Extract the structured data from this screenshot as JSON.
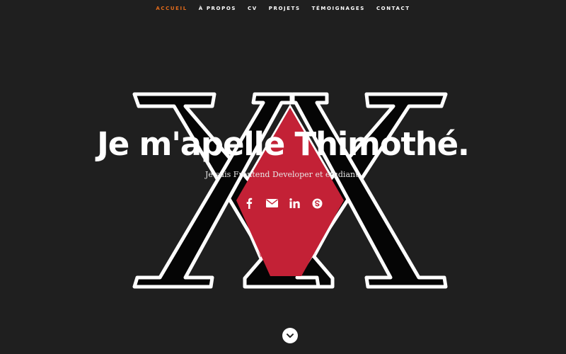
{
  "nav": {
    "items": [
      {
        "label": "ACCUEIL",
        "active": true
      },
      {
        "label": "À PROPOS",
        "active": false
      },
      {
        "label": "CV",
        "active": false
      },
      {
        "label": "PROJETS",
        "active": false
      },
      {
        "label": "TÉMOIGNAGES",
        "active": false
      },
      {
        "label": "CONTACT",
        "active": false
      }
    ],
    "active_color": "#e06a1b"
  },
  "hero": {
    "title": "Je m'apelle Thimothé.",
    "subtitle": "Je suis Frontend Developer et étudiant."
  },
  "social": [
    {
      "icon": "facebook-icon"
    },
    {
      "icon": "email-icon"
    },
    {
      "icon": "linkedin-icon"
    },
    {
      "icon": "skype-icon"
    }
  ],
  "scroll": {
    "icon": "chevron-down-icon"
  },
  "colors": {
    "background": "#1f1f1f",
    "logo_red": "#c32136",
    "logo_black": "#050505",
    "logo_white": "#ffffff"
  }
}
